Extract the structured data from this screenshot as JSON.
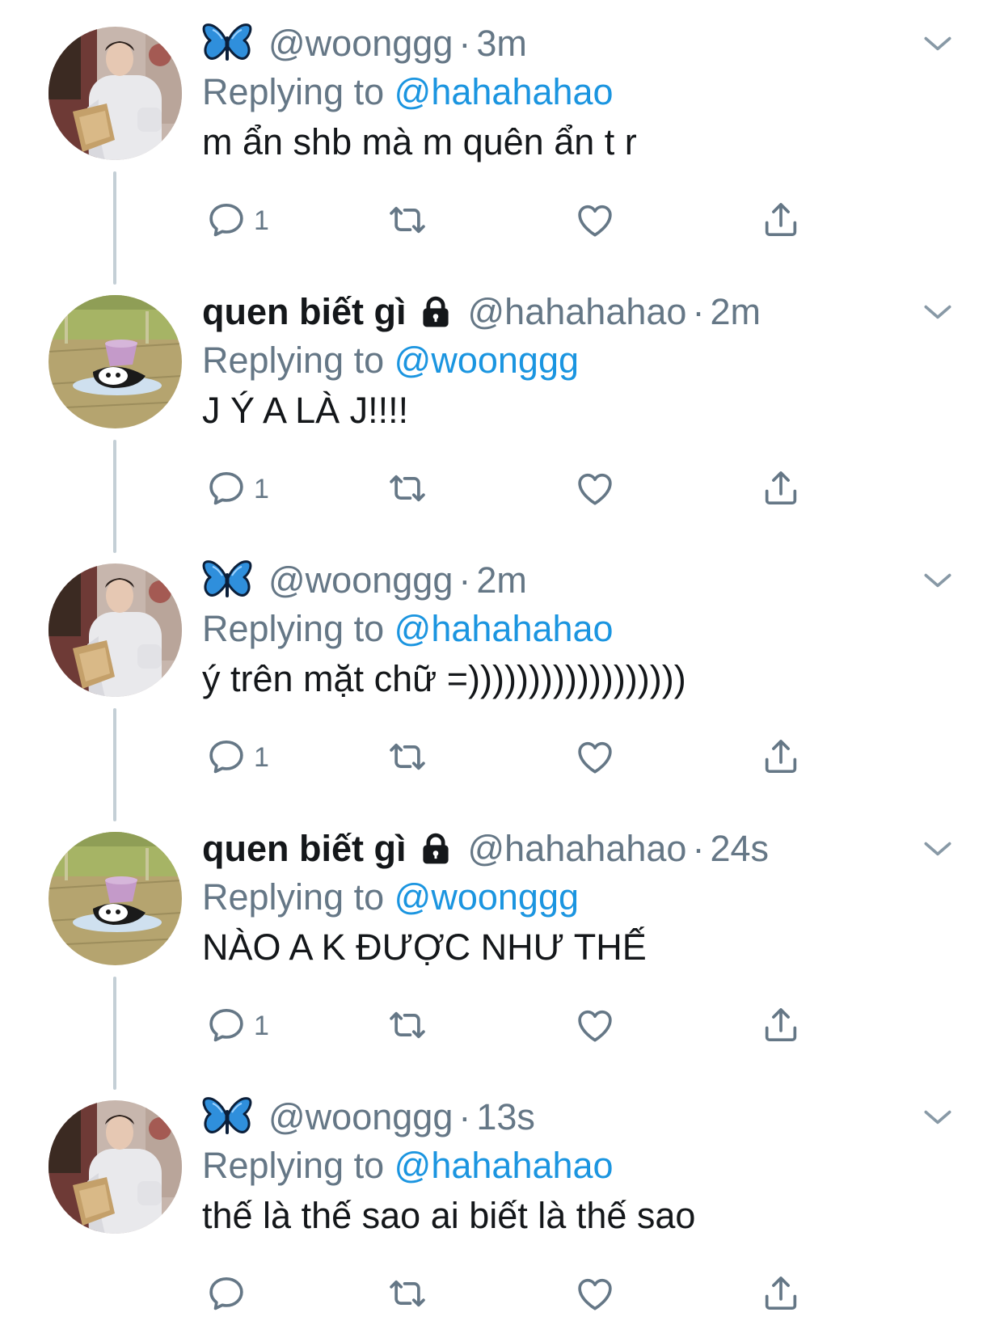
{
  "colors": {
    "accent": "#1b95e0",
    "secondary_text": "#657786",
    "primary_text": "#14171a",
    "thread_line": "#c4cfd6"
  },
  "tweets": [
    {
      "display_name": "",
      "display_icon": "butterfly-icon",
      "protected": false,
      "handle": "@woonggg",
      "separator": "·",
      "time": "3m",
      "replying_label": "Replying to",
      "replying_to": "@hahahahao",
      "text": "m ẩn shb mà m quên ẩn t r",
      "reply_count": "1",
      "avatar": "user-woonggg"
    },
    {
      "display_name": "quen biết gì",
      "display_icon": "",
      "protected": true,
      "handle": "@hahahahao",
      "separator": "·",
      "time": "2m",
      "replying_label": "Replying to",
      "replying_to": "@woonggg",
      "text": "J Ý A LÀ J!!!!",
      "reply_count": "1",
      "avatar": "user-hahahahao"
    },
    {
      "display_name": "",
      "display_icon": "butterfly-icon",
      "protected": false,
      "handle": "@woonggg",
      "separator": "·",
      "time": "2m",
      "replying_label": "Replying to",
      "replying_to": "@hahahahao",
      "text": "ý trên mặt chữ =))))))))))))))))))",
      "reply_count": "1",
      "avatar": "user-woonggg"
    },
    {
      "display_name": "quen biết gì",
      "display_icon": "",
      "protected": true,
      "handle": "@hahahahao",
      "separator": "·",
      "time": "24s",
      "replying_label": "Replying to",
      "replying_to": "@woonggg",
      "text": "NÀO A K ĐƯỢC NHƯ THẾ",
      "reply_count": "1",
      "avatar": "user-hahahahao"
    },
    {
      "display_name": "",
      "display_icon": "butterfly-icon",
      "protected": false,
      "handle": "@woonggg",
      "separator": "·",
      "time": "13s",
      "replying_label": "Replying to",
      "replying_to": "@hahahahao",
      "text": "thế là thế sao ai biết là thế sao",
      "reply_count": "",
      "avatar": "user-woonggg"
    }
  ]
}
